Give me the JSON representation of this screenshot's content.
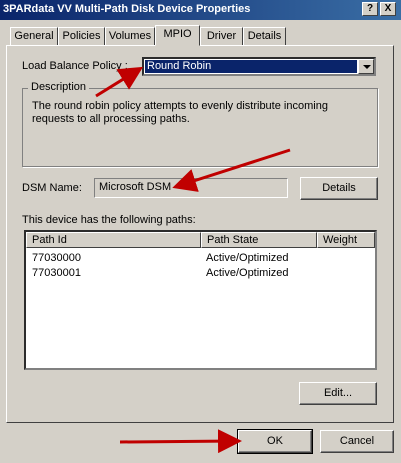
{
  "window": {
    "title": "3PARdata VV  Multi-Path Disk Device Properties",
    "help_glyph": "?",
    "close_glyph": "X"
  },
  "tabs": [
    {
      "label": "General"
    },
    {
      "label": "Policies"
    },
    {
      "label": "Volumes"
    },
    {
      "label": "MPIO",
      "active": true
    },
    {
      "label": "Driver"
    },
    {
      "label": "Details"
    }
  ],
  "mpio": {
    "load_balance_label": "Load Balance Policy :",
    "load_balance_value": "Round Robin",
    "description_title": "Description",
    "description_text": "The round robin policy attempts to evenly distribute incoming requests to all processing paths.",
    "dsm_label": "DSM Name:",
    "dsm_value": "Microsoft DSM",
    "details_button": "Details",
    "paths_label": "This device has the following paths:",
    "columns": [
      "Path Id",
      "Path State",
      "Weight"
    ],
    "paths": [
      {
        "id": "77030000",
        "state": "Active/Optimized",
        "weight": ""
      },
      {
        "id": "77030001",
        "state": "Active/Optimized",
        "weight": ""
      }
    ],
    "edit_button": "Edit..."
  },
  "footer": {
    "ok_button": "OK",
    "cancel_button": "Cancel"
  },
  "colors": {
    "face": "#d4d0c8",
    "titlebar": "#0a246a",
    "selection": "#0a246a",
    "annotation_arrow": "#c00000"
  }
}
